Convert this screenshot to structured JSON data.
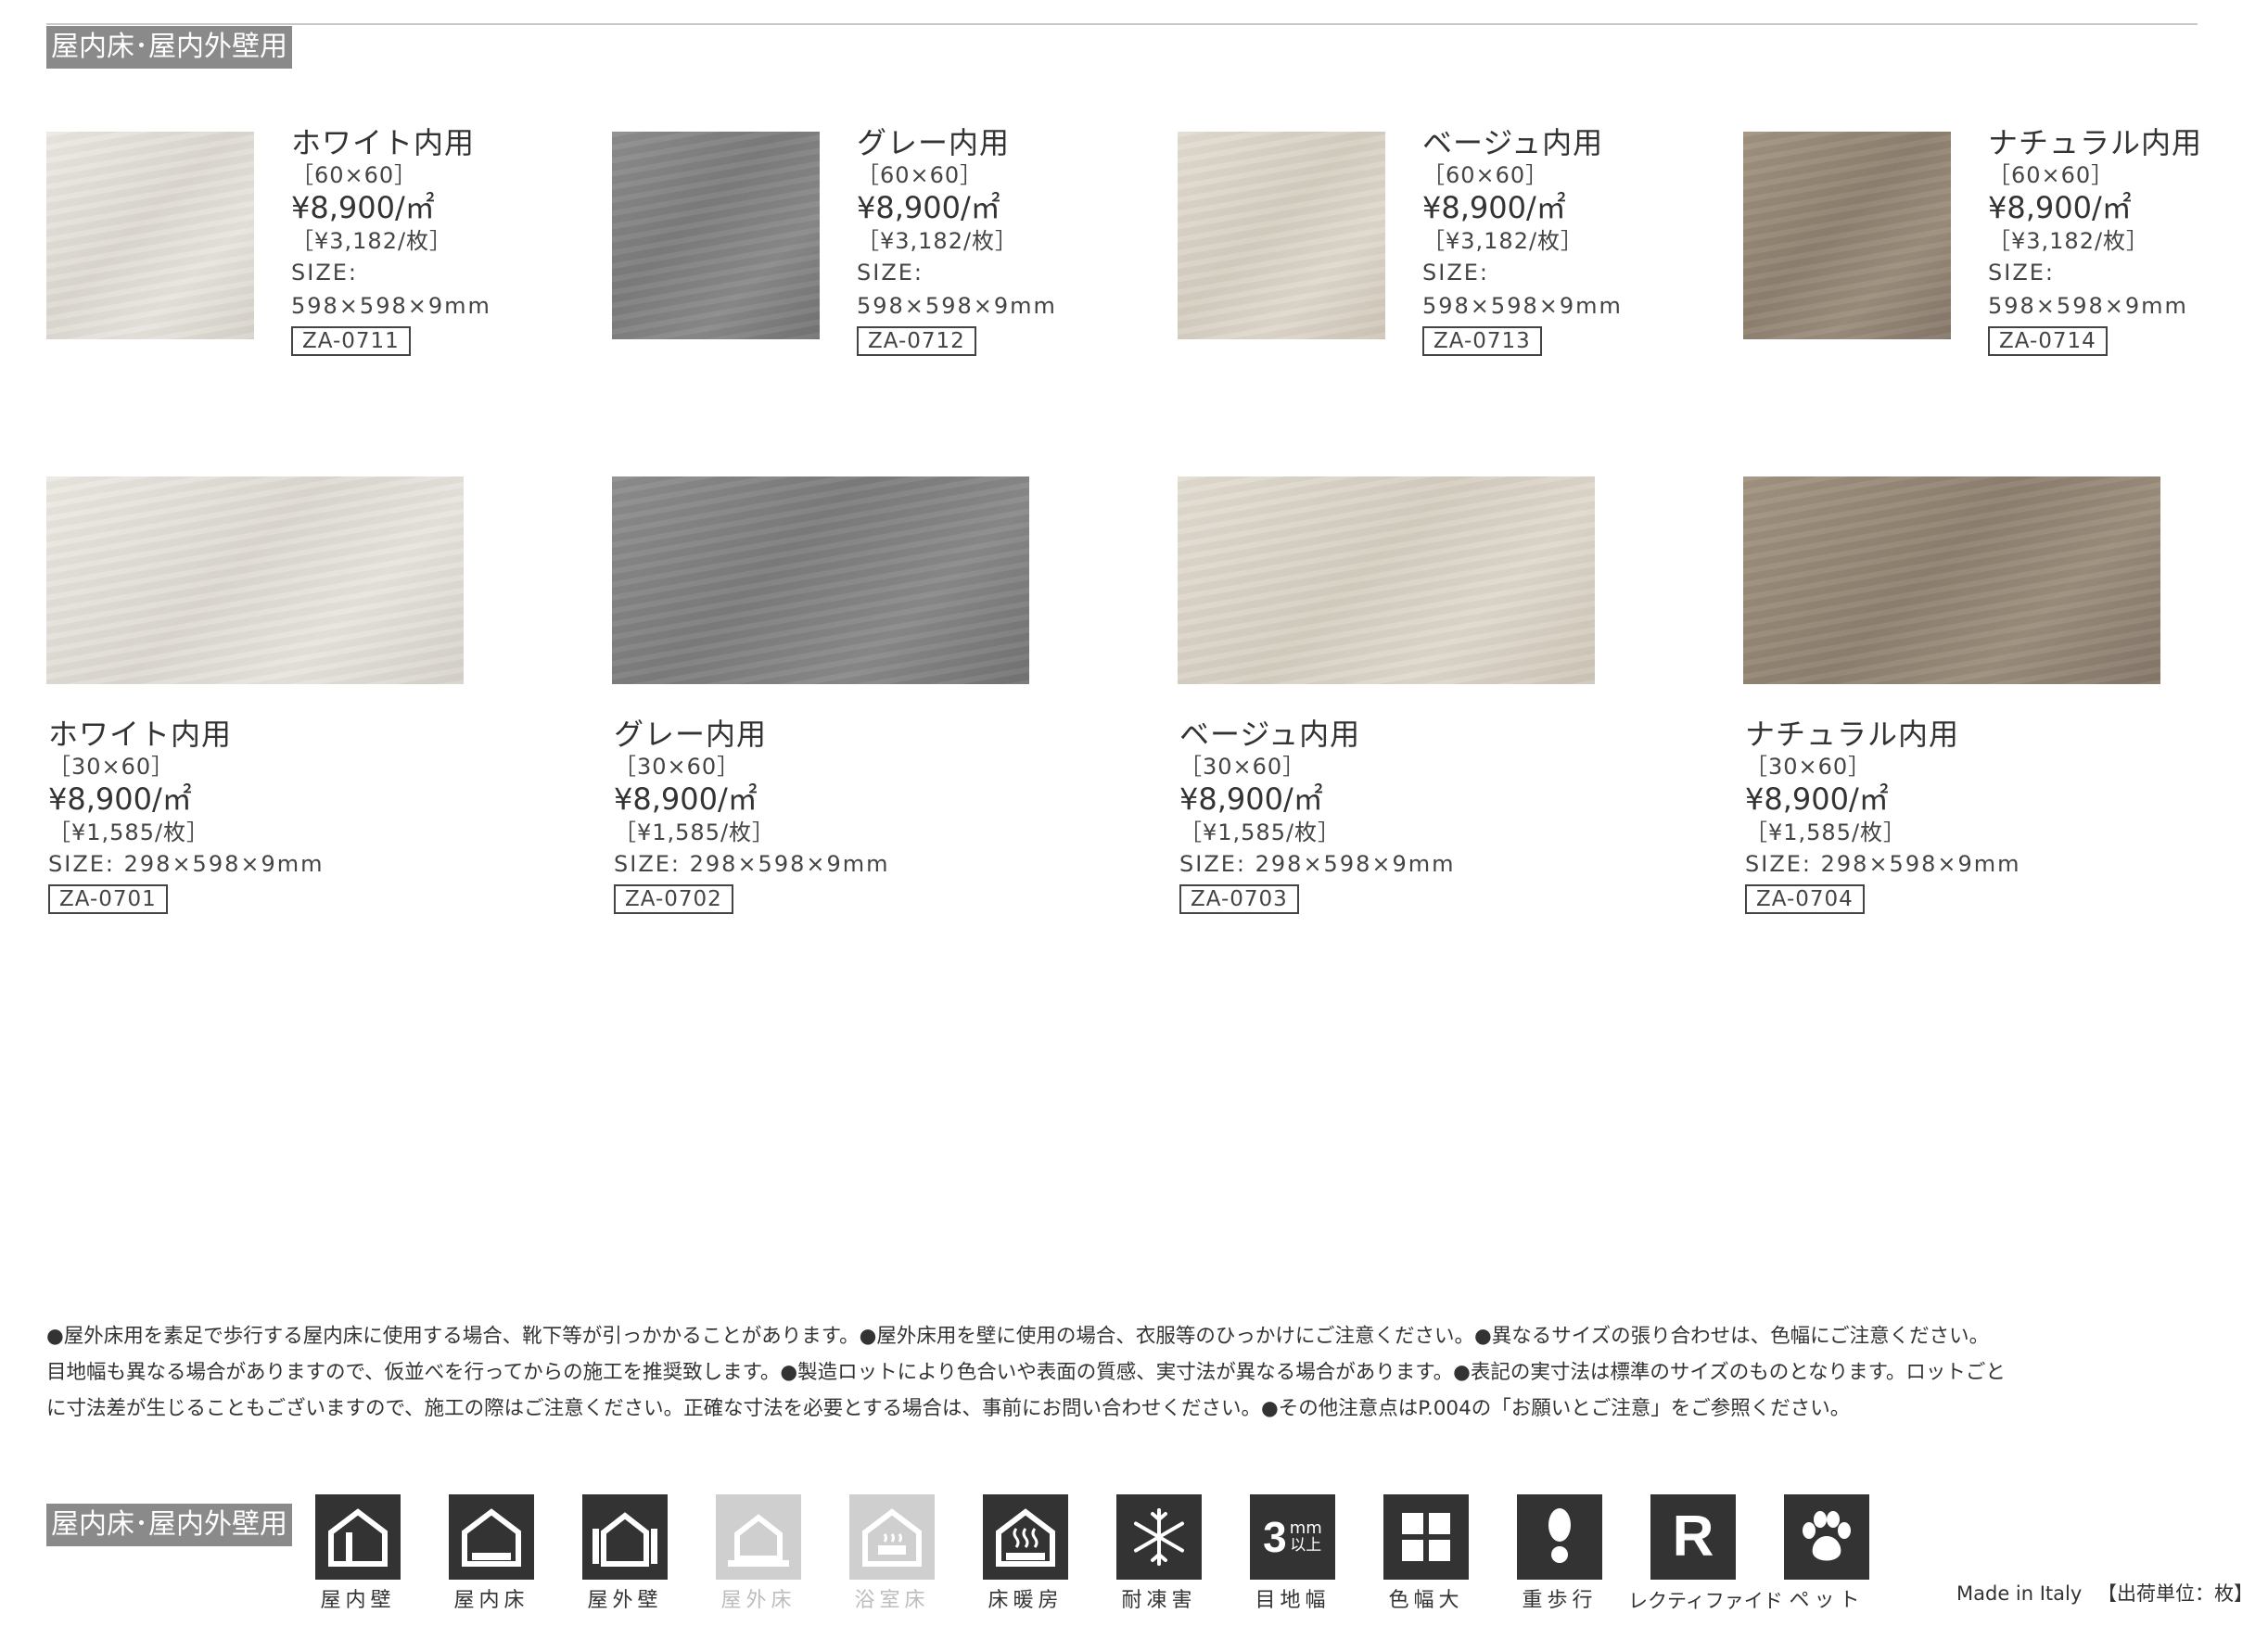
{
  "category_tag": "屋内床･屋内外壁用",
  "products_60x60": [
    {
      "name": "ホワイト内用",
      "dimension": "［60×60］",
      "price": "¥8,900/㎡",
      "per_piece": "［¥3,182/枚］",
      "size_label": "SIZE:",
      "size": "598×598×9mm",
      "code": "ZA-0711",
      "swatch": "#e6e3dd"
    },
    {
      "name": "グレー内用",
      "dimension": "［60×60］",
      "price": "¥8,900/㎡",
      "per_piece": "［¥3,182/枚］",
      "size_label": "SIZE:",
      "size": "598×598×9mm",
      "code": "ZA-0712",
      "swatch": "#858586"
    },
    {
      "name": "ベージュ内用",
      "dimension": "［60×60］",
      "price": "¥8,900/㎡",
      "per_piece": "［¥3,182/枚］",
      "size_label": "SIZE:",
      "size": "598×598×9mm",
      "code": "ZA-0713",
      "swatch": "#dbd4c8"
    },
    {
      "name": "ナチュラル内用",
      "dimension": "［60×60］",
      "price": "¥8,900/㎡",
      "per_piece": "［¥3,182/枚］",
      "size_label": "SIZE:",
      "size": "598×598×9mm",
      "code": "ZA-0714",
      "swatch": "#968878"
    }
  ],
  "products_30x60": [
    {
      "name": "ホワイト内用",
      "dimension": "［30×60］",
      "price": "¥8,900/㎡",
      "per_piece": "［¥1,585/枚］",
      "size": "SIZE: 298×598×9mm",
      "code": "ZA-0701"
    },
    {
      "name": "グレー内用",
      "dimension": "［30×60］",
      "price": "¥8,900/㎡",
      "per_piece": "［¥1,585/枚］",
      "size": "SIZE: 298×598×9mm",
      "code": "ZA-0702"
    },
    {
      "name": "ベージュ内用",
      "dimension": "［30×60］",
      "price": "¥8,900/㎡",
      "per_piece": "［¥1,585/枚］",
      "size": "SIZE: 298×598×9mm",
      "code": "ZA-0703"
    },
    {
      "name": "ナチュラル内用",
      "dimension": "［30×60］",
      "price": "¥8,900/㎡",
      "per_piece": "［¥1,585/枚］",
      "size": "SIZE: 298×598×9mm",
      "code": "ZA-0704"
    }
  ],
  "notes": [
    "●屋外床用を素足で歩行する屋内床に使用する場合、靴下等が引っかかることがあります。●屋外床用を壁に使用の場合、衣服等のひっかけにご注意ください。●異なるサイズの張り合わせは、色幅にご注意ください。",
    "目地幅も異なる場合がありますので、仮並べを行ってからの施工を推奨致します。●製造ロットにより色合いや表面の質感、実寸法が異なる場合があります。●表記の実寸法は標準のサイズのものとなります。ロットごと",
    "に寸法差が生じることもございますので、施工の際はご注意ください。正確な寸法を必要とする場合は、事前にお問い合わせください。●その他注意点はP.004の「お願いとご注意」をご参照ください。"
  ],
  "usage_icons": [
    {
      "label": "屋内壁",
      "icon": "indoor-wall-icon",
      "active": true
    },
    {
      "label": "屋内床",
      "icon": "indoor-floor-icon",
      "active": true
    },
    {
      "label": "屋外壁",
      "icon": "outdoor-wall-icon",
      "active": true
    },
    {
      "label": "屋外床",
      "icon": "outdoor-floor-icon",
      "active": false
    },
    {
      "label": "浴室床",
      "icon": "bathroom-floor-icon",
      "active": false
    },
    {
      "label": "床暖房",
      "icon": "floor-heating-icon",
      "active": true
    },
    {
      "label": "耐凍害",
      "icon": "frost-resistance-icon",
      "active": true
    },
    {
      "label": "目地幅",
      "icon": "joint-width-icon",
      "active": true,
      "badge_number": "3",
      "badge_unit": "mm",
      "badge_note": "以上"
    },
    {
      "label": "色幅大",
      "icon": "color-variation-icon",
      "active": true
    },
    {
      "label": "重歩行",
      "icon": "heavy-traffic-icon",
      "active": true
    },
    {
      "label": "レクティファイド",
      "icon": "rectified-icon",
      "active": true,
      "badge_letter": "R"
    },
    {
      "label": "ペット",
      "icon": "pet-icon",
      "active": true
    }
  ],
  "footer": {
    "origin": "Made in Italy",
    "unit": "【出荷単位：枚】"
  },
  "colors": {
    "tag_bg": "#8a8a8a",
    "icon_active": "#333333",
    "icon_inactive": "#cfcfcf",
    "text": "#333333"
  }
}
